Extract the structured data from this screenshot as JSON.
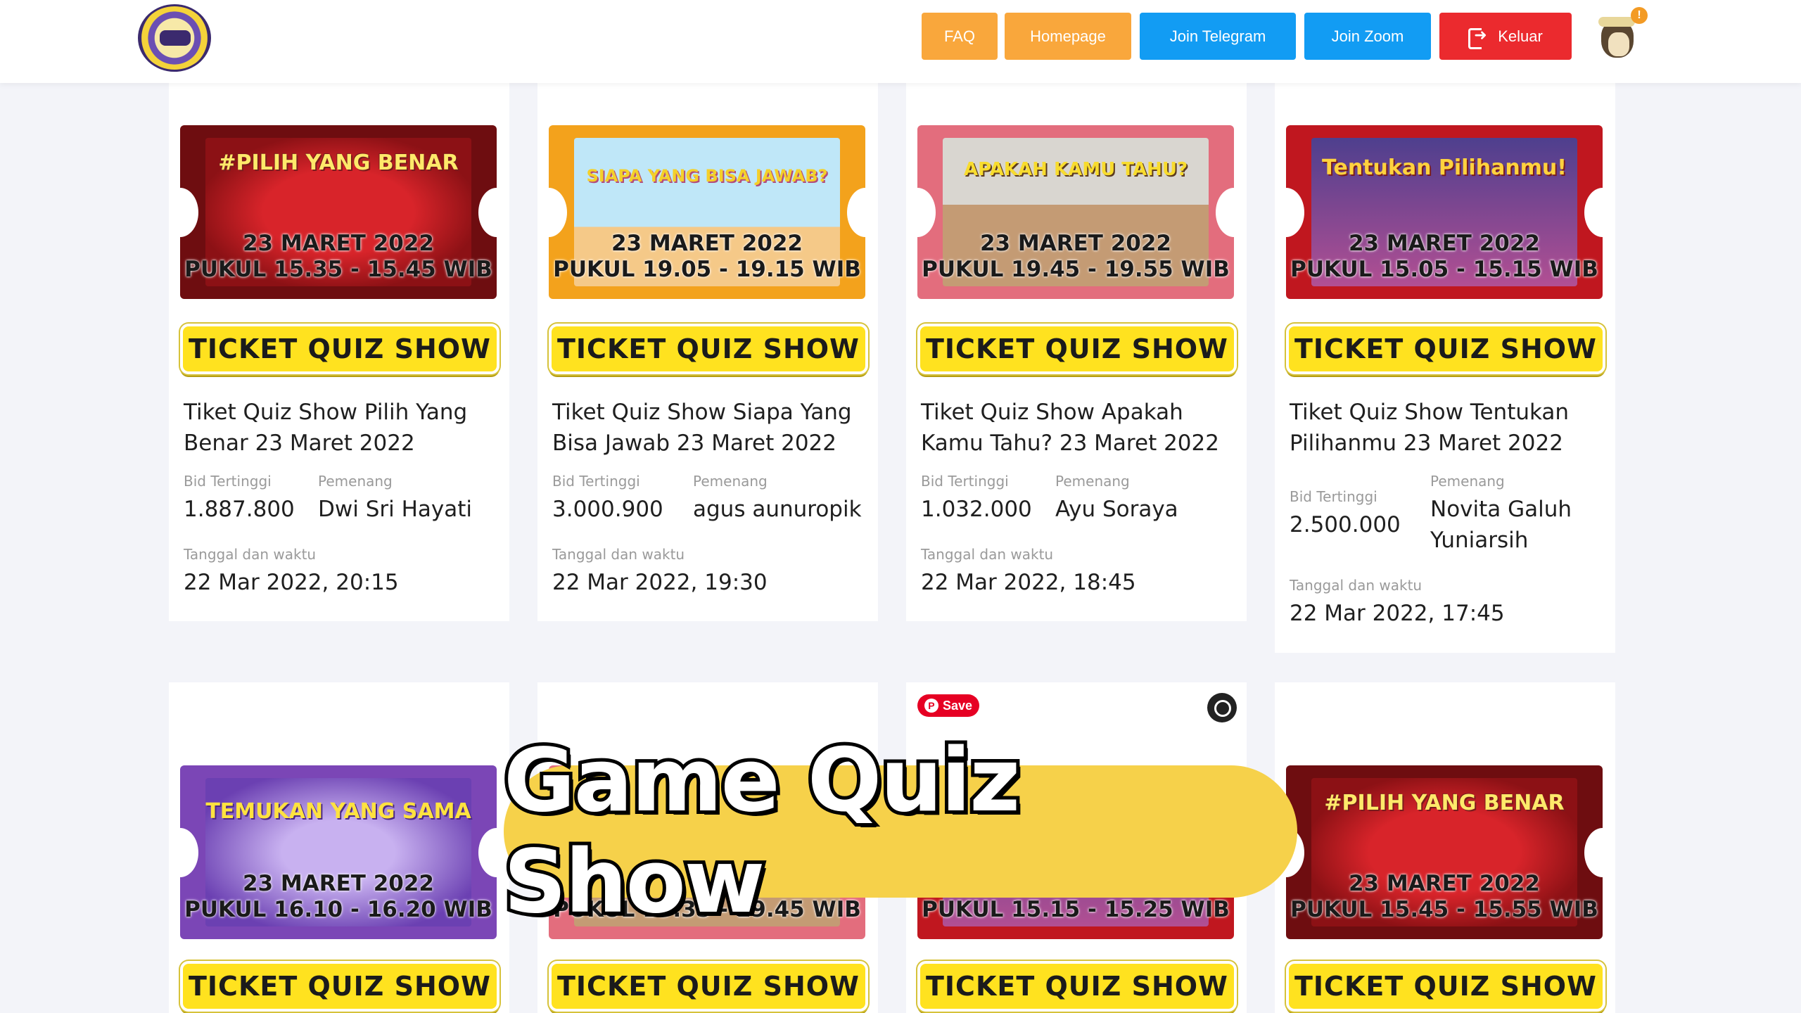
{
  "header": {
    "nav": {
      "faq": "FAQ",
      "homepage": "Homepage",
      "join_telegram": "Join Telegram",
      "join_zoom": "Join Zoom",
      "logout": "Keluar"
    },
    "notification_badge": "!"
  },
  "ticket_button_label": "TICKET QUIZ SHOW",
  "labels": {
    "bid": "Bid Tertinggi",
    "winner": "Pemenang",
    "datetime": "Tanggal dan waktu"
  },
  "cards": [
    {
      "banner_title": "#PILIH YANG BENAR",
      "banner_date": "23 MARET 2022",
      "banner_time": "PUKUL 15.35 - 15.45 WIB",
      "title": "Tiket Quiz Show Pilih Yang Benar 23 Maret 2022",
      "bid": "1.887.800",
      "winner": "Dwi Sri Hayati",
      "datetime": "22 Mar 2022, 20:15"
    },
    {
      "banner_title": "SIAPA YANG BISA JAWAB?",
      "banner_date": "23 MARET 2022",
      "banner_time": "PUKUL 19.05 - 19.15 WIB",
      "title": "Tiket Quiz Show Siapa Yang Bisa Jawab 23 Maret 2022",
      "bid": "3.000.900",
      "winner": "agus aunuropik",
      "datetime": "22 Mar 2022, 19:30"
    },
    {
      "banner_title": "APAKAH KAMU TAHU?",
      "banner_date": "23 MARET 2022",
      "banner_time": "PUKUL 19.45 - 19.55 WIB",
      "title": "Tiket Quiz Show Apakah Kamu Tahu? 23 Maret 2022",
      "bid": "1.032.000",
      "winner": "Ayu Soraya",
      "datetime": "22 Mar 2022, 18:45"
    },
    {
      "banner_title": "Tentukan Pilihanmu!",
      "banner_date": "23 MARET 2022",
      "banner_time": "PUKUL 15.05 - 15.15 WIB",
      "title": "Tiket Quiz Show Tentukan Pilihanmu 23 Maret 2022",
      "bid": "2.500.000",
      "winner": "Novita Galuh Yuniarsih",
      "datetime": "22 Mar 2022, 17:45"
    }
  ],
  "row2": [
    {
      "banner_title": "TEMUKAN YANG SAMA",
      "banner_date": "23 MARET 2022",
      "banner_time": "PUKUL 16.10 - 16.20 WIB"
    },
    {
      "banner_time": "PUKUL 19.35 - 19.45 WIB"
    },
    {
      "banner_time": "PUKUL 15.15 - 15.25 WIB"
    },
    {
      "banner_title": "#PILIH YANG BENAR",
      "banner_date": "23 MARET 2022",
      "banner_time": "PUKUL 15.45 - 15.55 WIB"
    }
  ],
  "overlay": {
    "title": "Game Quiz Show",
    "save_label": "Save"
  },
  "colors": {
    "faq": "#f9a73c",
    "telegram": "#129cf3",
    "logout": "#eb2a2e",
    "ticket_button": "#ffe21f",
    "overlay_pill": "#f6d14a"
  }
}
